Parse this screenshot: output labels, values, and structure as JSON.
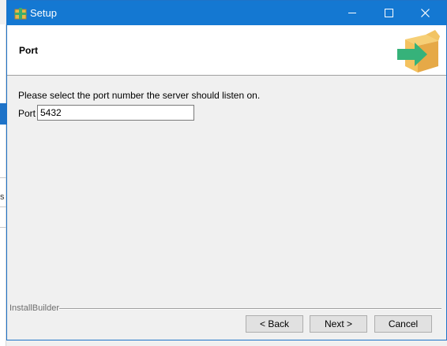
{
  "window": {
    "title": "Setup",
    "title_bar_color": "#1478d2",
    "controls": [
      "minimize-icon",
      "maximize-icon",
      "close-icon"
    ]
  },
  "header": {
    "title": "Port",
    "icon": "installer-box-arrow-icon"
  },
  "body": {
    "prompt": "Please select the port number the server should listen on.",
    "port_label": "Port",
    "port_value": "5432"
  },
  "footer": {
    "brand": "InstallBuilder",
    "back_label": "< Back",
    "next_label": "Next >",
    "cancel_label": "Cancel"
  },
  "background_window": {
    "partial_text": "s"
  }
}
